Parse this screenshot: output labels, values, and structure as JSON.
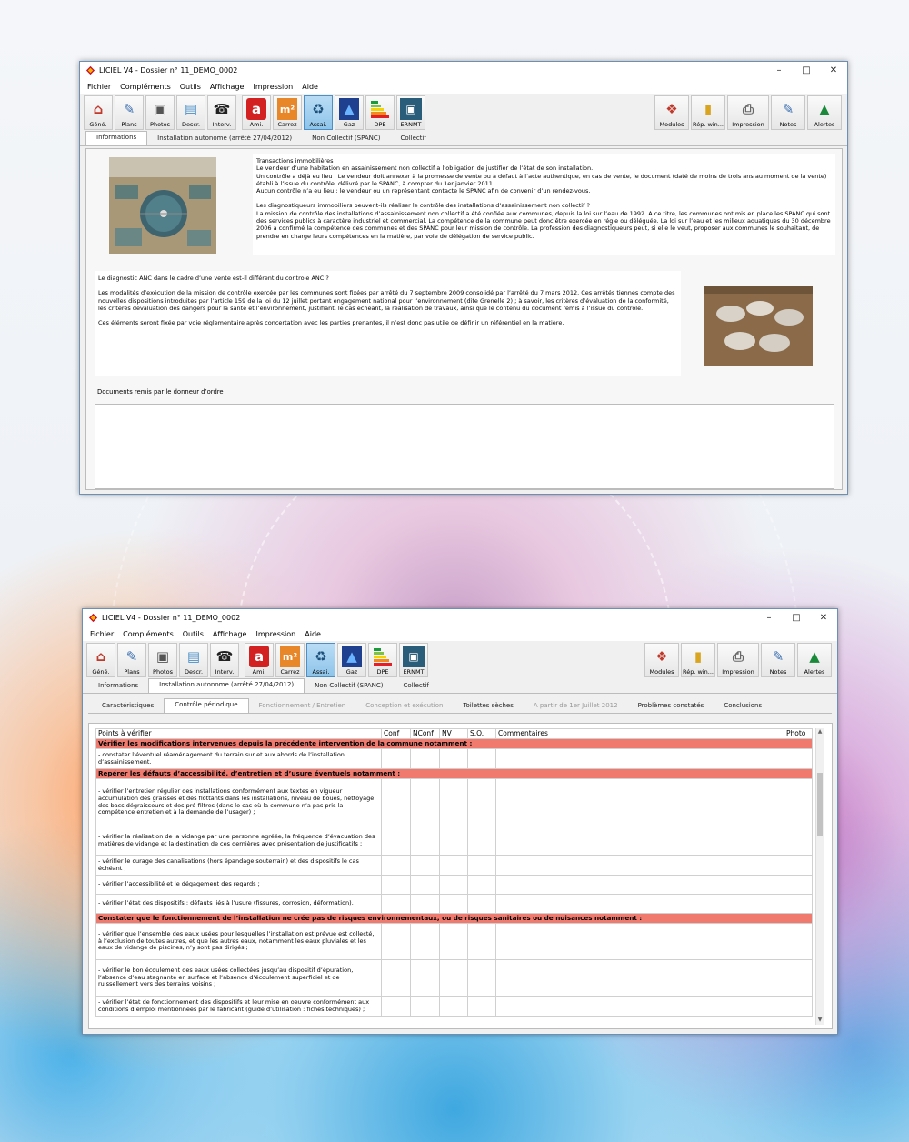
{
  "window_top": {
    "title": "LICIEL V4 - Dossier n° 11_DEMO_0002",
    "menu": [
      "Fichier",
      "Compléments",
      "Outils",
      "Affichage",
      "Impression",
      "Aide"
    ],
    "toolbar_left": [
      "Géné.",
      "Plans",
      "Photos",
      "Descr.",
      "Interv.",
      "Ami.",
      "Carrez",
      "Assai.",
      "Gaz",
      "DPE",
      "ERNMT"
    ],
    "toolbar_right": [
      "Modules",
      "Rép. win...",
      "Impression",
      "Notes",
      "Alertes"
    ],
    "tabs": [
      "Informations",
      "Installation autonome (arrêté 27/04/2012)",
      "Non Collectif (SPANC)",
      "Collectif"
    ],
    "block1": [
      "Transactions immobilières",
      "Le vendeur d’une habitation en assainissement non collectif a l’obligation de justifier de l’état de son installation.",
      "Un contrôle a déjà eu lieu : Le vendeur doit annexer à la promesse de vente ou à défaut à l’acte authentique, en cas de vente, le document (daté de moins de trois ans au moment de la vente) établi à l’issue du contrôle, délivré par le SPANC, à compter du 1er janvier 2011.",
      "Aucun contrôle n’a eu lieu : le vendeur ou un représentant contacte le SPANC afin de convenir d’un rendez-vous.",
      "Les diagnostiqueurs immobiliers peuvent-ils réaliser le contrôle des installations d’assainissement non collectif ?",
      "La mission de contrôle des installations d’assainissement non collectif a été confiée aux communes, depuis la loi sur l’eau de 1992. A ce titre, les communes ont mis en place les SPANC qui sont des services publics à caractère industriel et commercial. La compétence de la commune peut donc être exercée en régie ou déléguée. La loi sur l’eau et les milieux aquatiques du 30 décembre 2006 a confirmé la compétence des communes et des SPANC pour leur mission de contrôle. La profession des diagnostiqueurs peut, si elle le veut, proposer aux communes le souhaitant, de prendre en charge leurs compétences en la matière, par voie de délégation de service public."
    ],
    "block2": [
      "Le diagnostic ANC dans le cadre d’une vente est-il différent du controle ANC ?",
      "Les modalités d’exécution de la mission de contrôle exercée par les communes sont fixées par arrêté du 7 septembre 2009 consolidé par l’arrêté du 7 mars 2012. Ces arrêtés tiennes compte des nouvelles dispositions introduites par l’article 159 de la loi du 12 juillet portant engagement national pour l’environnement (dite Grenelle 2) ; à savoir, les critères d’évaluation de la conformité, les critères dévaluation des dangers pour la santé et l’environnement, justifiant, le cas échéant, la réalisation de travaux, ainsi que le contenu du document remis à l’issue du contrôle.",
      "Ces éléments seront fixée par voie réglementaire après concertation avec les parties prenantes, il n’est donc pas utile de définir un référentiel en la matière."
    ],
    "docs_label": "Documents remis par le donneur d’ordre"
  },
  "window_bottom": {
    "title": "LICIEL V4 - Dossier n° 11_DEMO_0002",
    "menu": [
      "Fichier",
      "Compléments",
      "Outils",
      "Affichage",
      "Impression",
      "Aide"
    ],
    "toolbar_left": [
      "Géné.",
      "Plans",
      "Photos",
      "Descr.",
      "Interv.",
      "Ami.",
      "Carrez",
      "Assai.",
      "Gaz",
      "DPE",
      "ERNMT"
    ],
    "toolbar_right": [
      "Modules",
      "Rép. win...",
      "Impression",
      "Notes",
      "Alertes"
    ],
    "tabs": [
      "Informations",
      "Installation autonome (arrêté 27/04/2012)",
      "Non Collectif (SPANC)",
      "Collectif"
    ],
    "subtabs": [
      "Caractéristiques",
      "Contrôle périodique",
      "Fonctionnement / Entretien",
      "Conception et exécution",
      "Toilettes sèches",
      "A partir de 1er Juillet 2012",
      "Problèmes constatés",
      "Conclusions"
    ],
    "columns": [
      "Points à vérifier",
      "Conf",
      "NConf",
      "NV",
      "S.O.",
      "Commentaires",
      "Photo"
    ],
    "rows": [
      {
        "type": "hdr",
        "text": "Vérifier les modifications intervenues depuis la précédente intervention de la commune notamment :"
      },
      {
        "type": "item",
        "text": "- constater l’éventuel réaménagement du terrain sur et aux abords de l’installation d’assainissement."
      },
      {
        "type": "hdr",
        "text": "Repérer les défauts d’accessibilité, d’entretien et d’usure éventuels notamment :"
      },
      {
        "type": "item",
        "text": "- vérifier l’entretien régulier des installations conformément aux textes en vigueur : accumulation des graisses et des flottants dans les installations, niveau de boues, nettoyage des bacs dégraisseurs et des pré-filtres (dans le cas où la commune n’a pas pris la compétence entretien et à la demande de l’usager) ;"
      },
      {
        "type": "item",
        "text": "- vérifier la réalisation de la vidange par une personne agréée, la fréquence d’évacuation des matières de vidange et la destination de ces dernières avec présentation de justificatifs ;"
      },
      {
        "type": "item",
        "text": "- vérifier le curage des canalisations (hors épandage souterrain) et des dispositifs le cas échéant ;"
      },
      {
        "type": "item",
        "text": "- vérifier l’accessibilité et le dégagement des regards ;"
      },
      {
        "type": "item",
        "text": "- vérifier l’état des dispositifs : défauts liés à l’usure (fissures, corrosion, déformation)."
      },
      {
        "type": "hdr",
        "text": "Constater que le fonctionnement de l’installation ne crée pas de risques environnementaux, ou de risques sanitaires ou de nuisances notamment :"
      },
      {
        "type": "item",
        "text": "- vérifier que l’ensemble des eaux usées pour lesquelles l’installation est prévue est collecté, à l’exclusion de toutes autres, et que les autres eaux, notamment les eaux pluviales et les eaux de vidange de piscines, n’y sont pas dirigés ;"
      },
      {
        "type": "item",
        "text": "- vérifier le bon écoulement des eaux usées collectées jusqu’au dispositif d’épuration, l’absence d’eau stagnante en surface et l’absence d’écoulement superficiel et de ruissellement vers des terrains voisins ;"
      },
      {
        "type": "item",
        "text": "- vérifier l’état de fonctionnement des dispositifs et leur mise en oeuvre conformément aux conditions d’emploi mentionnées par le fabricant (guide d’utilisation : fiches techniques) ;"
      }
    ]
  },
  "colors": {
    "accent_red": "#f07a6e",
    "window_border": "#6d8fb3"
  }
}
